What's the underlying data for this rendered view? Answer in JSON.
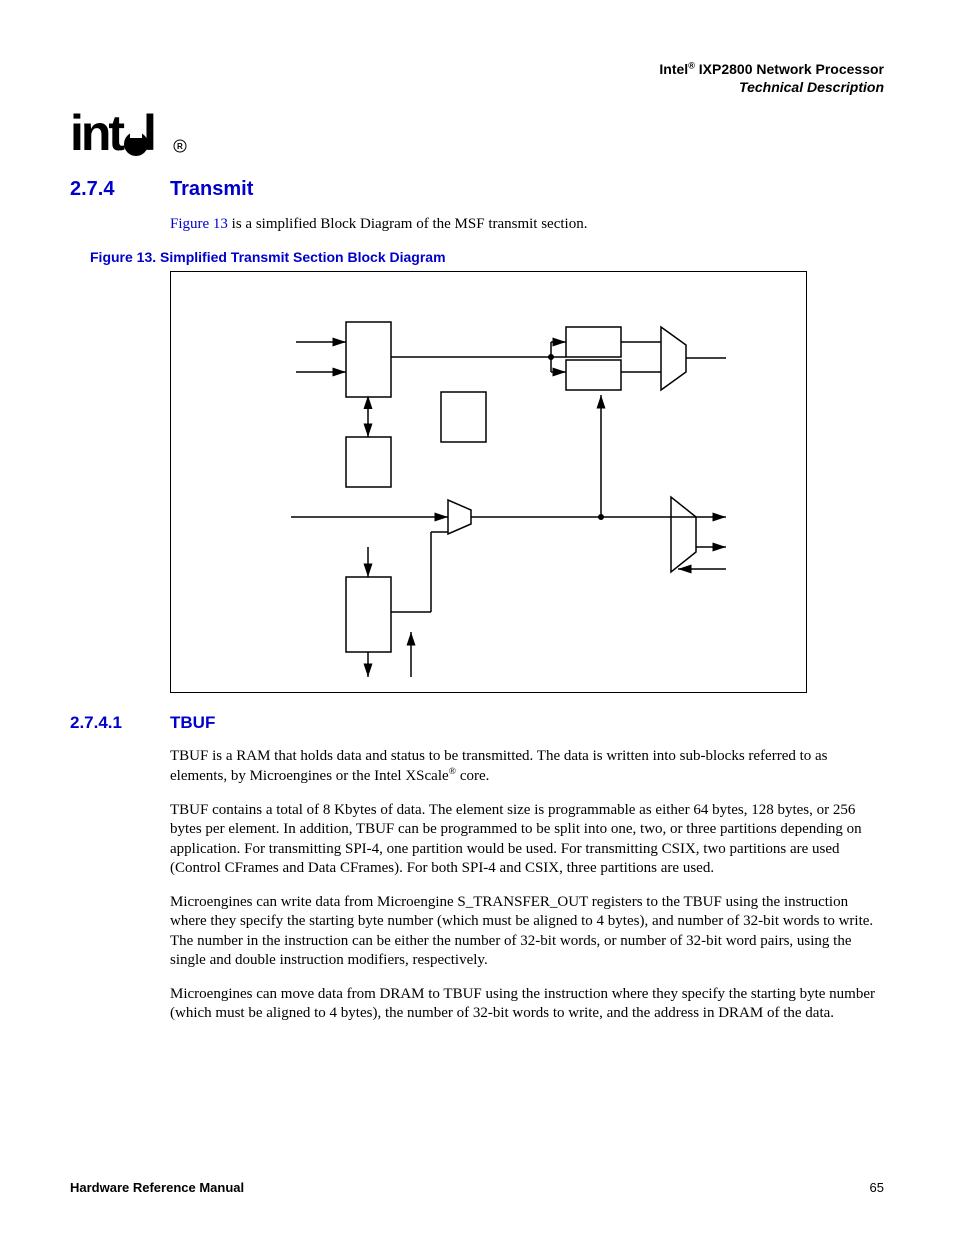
{
  "header": {
    "product_prefix": "Intel",
    "product_name": "IXP2800 Network Processor",
    "subtitle": "Technical Description"
  },
  "logo": {
    "text": "intel",
    "reg": "®"
  },
  "section": {
    "number": "2.7.4",
    "title": "Transmit"
  },
  "intro": {
    "link_text": "Figure 13",
    "rest": " is a simplified Block Diagram of the MSF transmit section."
  },
  "figure": {
    "caption": "Figure 13. Simplified Transmit Section Block Diagram"
  },
  "subsection": {
    "number": "2.7.4.1",
    "title": "TBUF"
  },
  "para1_a": "TBUF is a RAM that holds data and status to be transmitted. The data is written into sub-blocks referred to as elements, by Microengines or the Intel XScale",
  "para1_reg": "®",
  "para1_b": " core.",
  "para2": "TBUF contains a total of 8 Kbytes of data. The element size is programmable as either 64 bytes, 128 bytes, or 256 bytes per element. In addition, TBUF can be programmed to be split into one, two, or three partitions depending on application. For transmitting SPI-4, one partition would be used. For transmitting CSIX, two partitions are used (Control CFrames and Data CFrames). For both SPI-4 and CSIX, three partitions are used.",
  "para3": "Microengines can write data from Microengine S_TRANSFER_OUT registers to the TBUF using the                       instruction where they specify the starting byte number (which must be aligned to 4 bytes), and number of 32-bit words to write. The number in the instruction can be either the number of 32-bit words, or number of 32-bit word pairs, using the single and double instruction modifiers, respectively.",
  "para4": "Microengines can move data from DRAM to TBUF using the           instruction where they specify the starting byte number (which must be aligned to 4 bytes), the number of 32-bit words to write, and the address in DRAM of the data.",
  "footer": {
    "left": "Hardware Reference Manual",
    "right": "65"
  }
}
